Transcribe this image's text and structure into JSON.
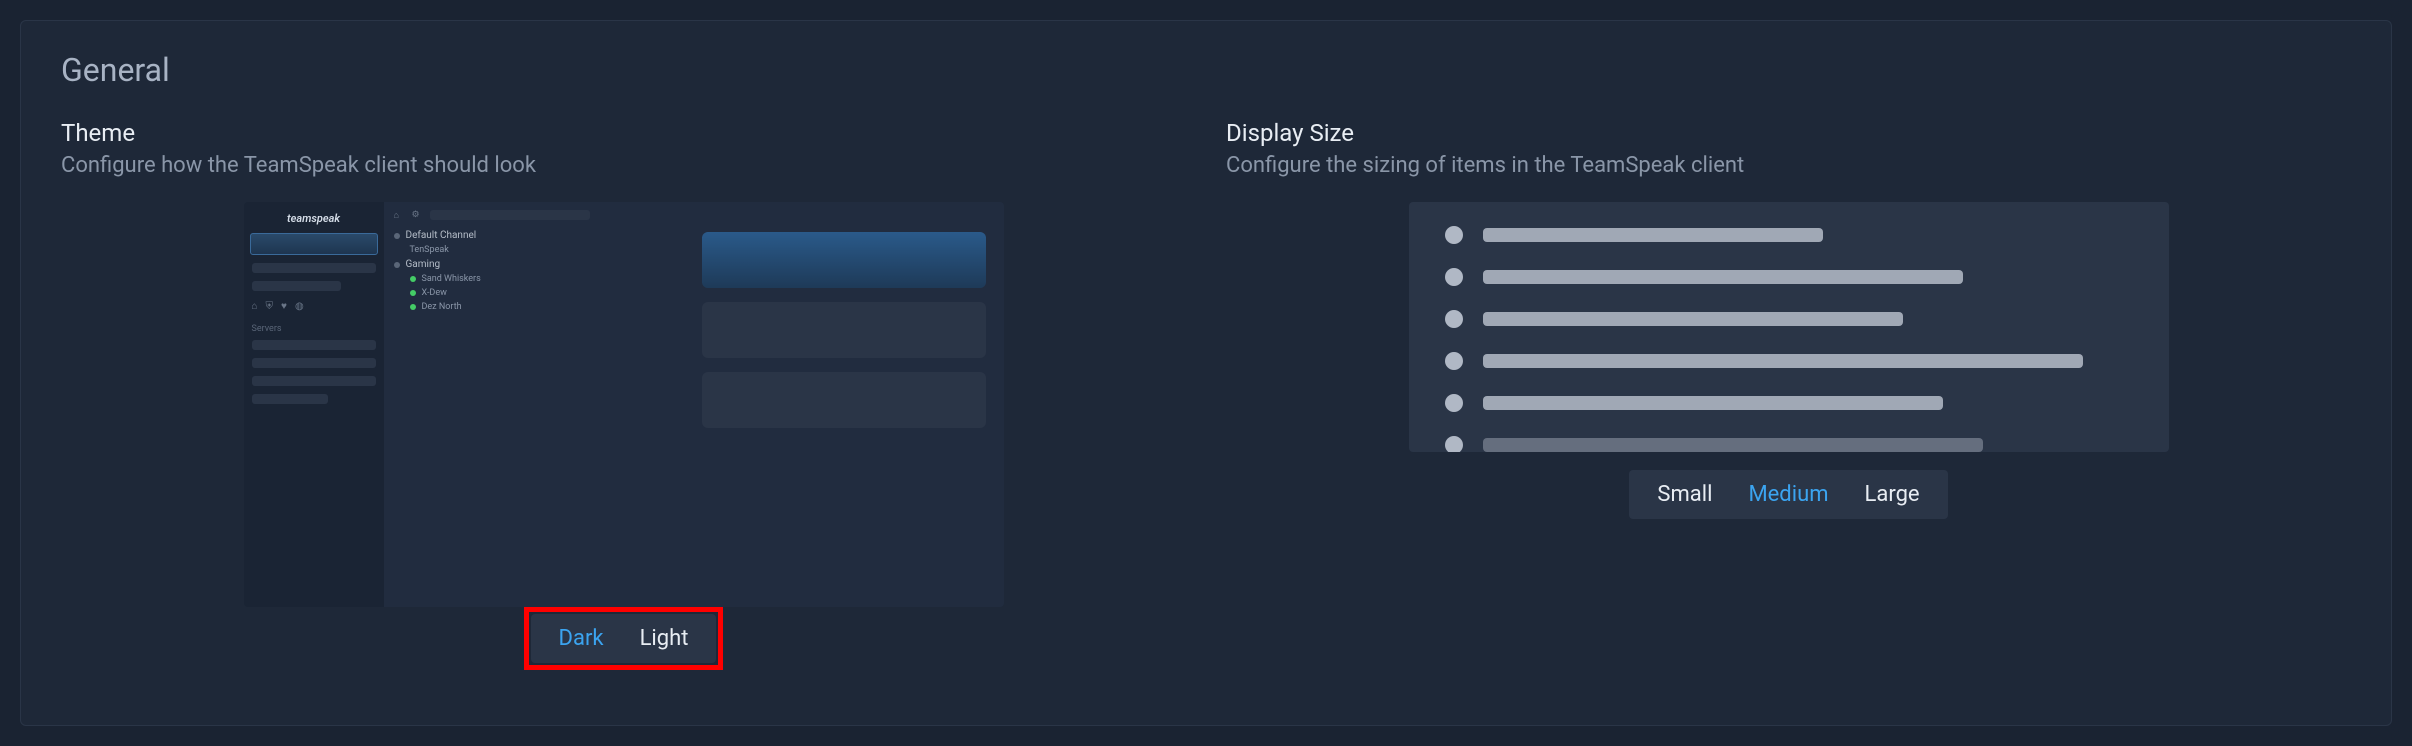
{
  "section": {
    "title": "General"
  },
  "theme": {
    "title": "Theme",
    "description": "Configure how the TeamSpeak client should look",
    "options": {
      "dark": "Dark",
      "light": "Light"
    },
    "selected": "dark",
    "preview": {
      "logo": "teamspeak",
      "serversLabel": "Servers",
      "channels": [
        {
          "name": "Default Channel",
          "type": "header"
        },
        {
          "name": "TenSpeak",
          "type": "sub"
        },
        {
          "name": "Gaming",
          "type": "header"
        },
        {
          "name": "Sand Whiskers",
          "type": "sub"
        },
        {
          "name": "X-Dew",
          "type": "sub"
        },
        {
          "name": "Dez North",
          "type": "sub"
        }
      ]
    }
  },
  "displaySize": {
    "title": "Display Size",
    "description": "Configure the sizing of items in the TeamSpeak client",
    "options": {
      "small": "Small",
      "medium": "Medium",
      "large": "Large"
    },
    "selected": "medium"
  }
}
